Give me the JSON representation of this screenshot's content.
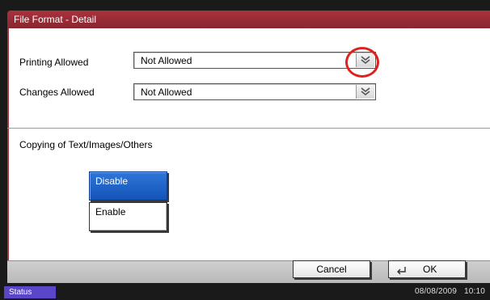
{
  "window": {
    "title": "File Format - Detail"
  },
  "fields": [
    {
      "label": "Printing Allowed",
      "value": "Not Allowed"
    },
    {
      "label": "Changes Allowed",
      "value": "Not Allowed"
    }
  ],
  "copying": {
    "label": "Copying of Text/Images/Others",
    "options": [
      {
        "label": "Disable",
        "selected": true
      },
      {
        "label": "Enable",
        "selected": false
      }
    ]
  },
  "footer": {
    "cancel_label": "Cancel",
    "ok_label": "OK"
  },
  "statusbar": {
    "status_label": "Status",
    "datetime": "08/08/2009   10:10"
  },
  "colors": {
    "accent": "#a8323c",
    "selected": "#1454b8",
    "highlight": "#e0201c",
    "status": "#5a46c8"
  }
}
